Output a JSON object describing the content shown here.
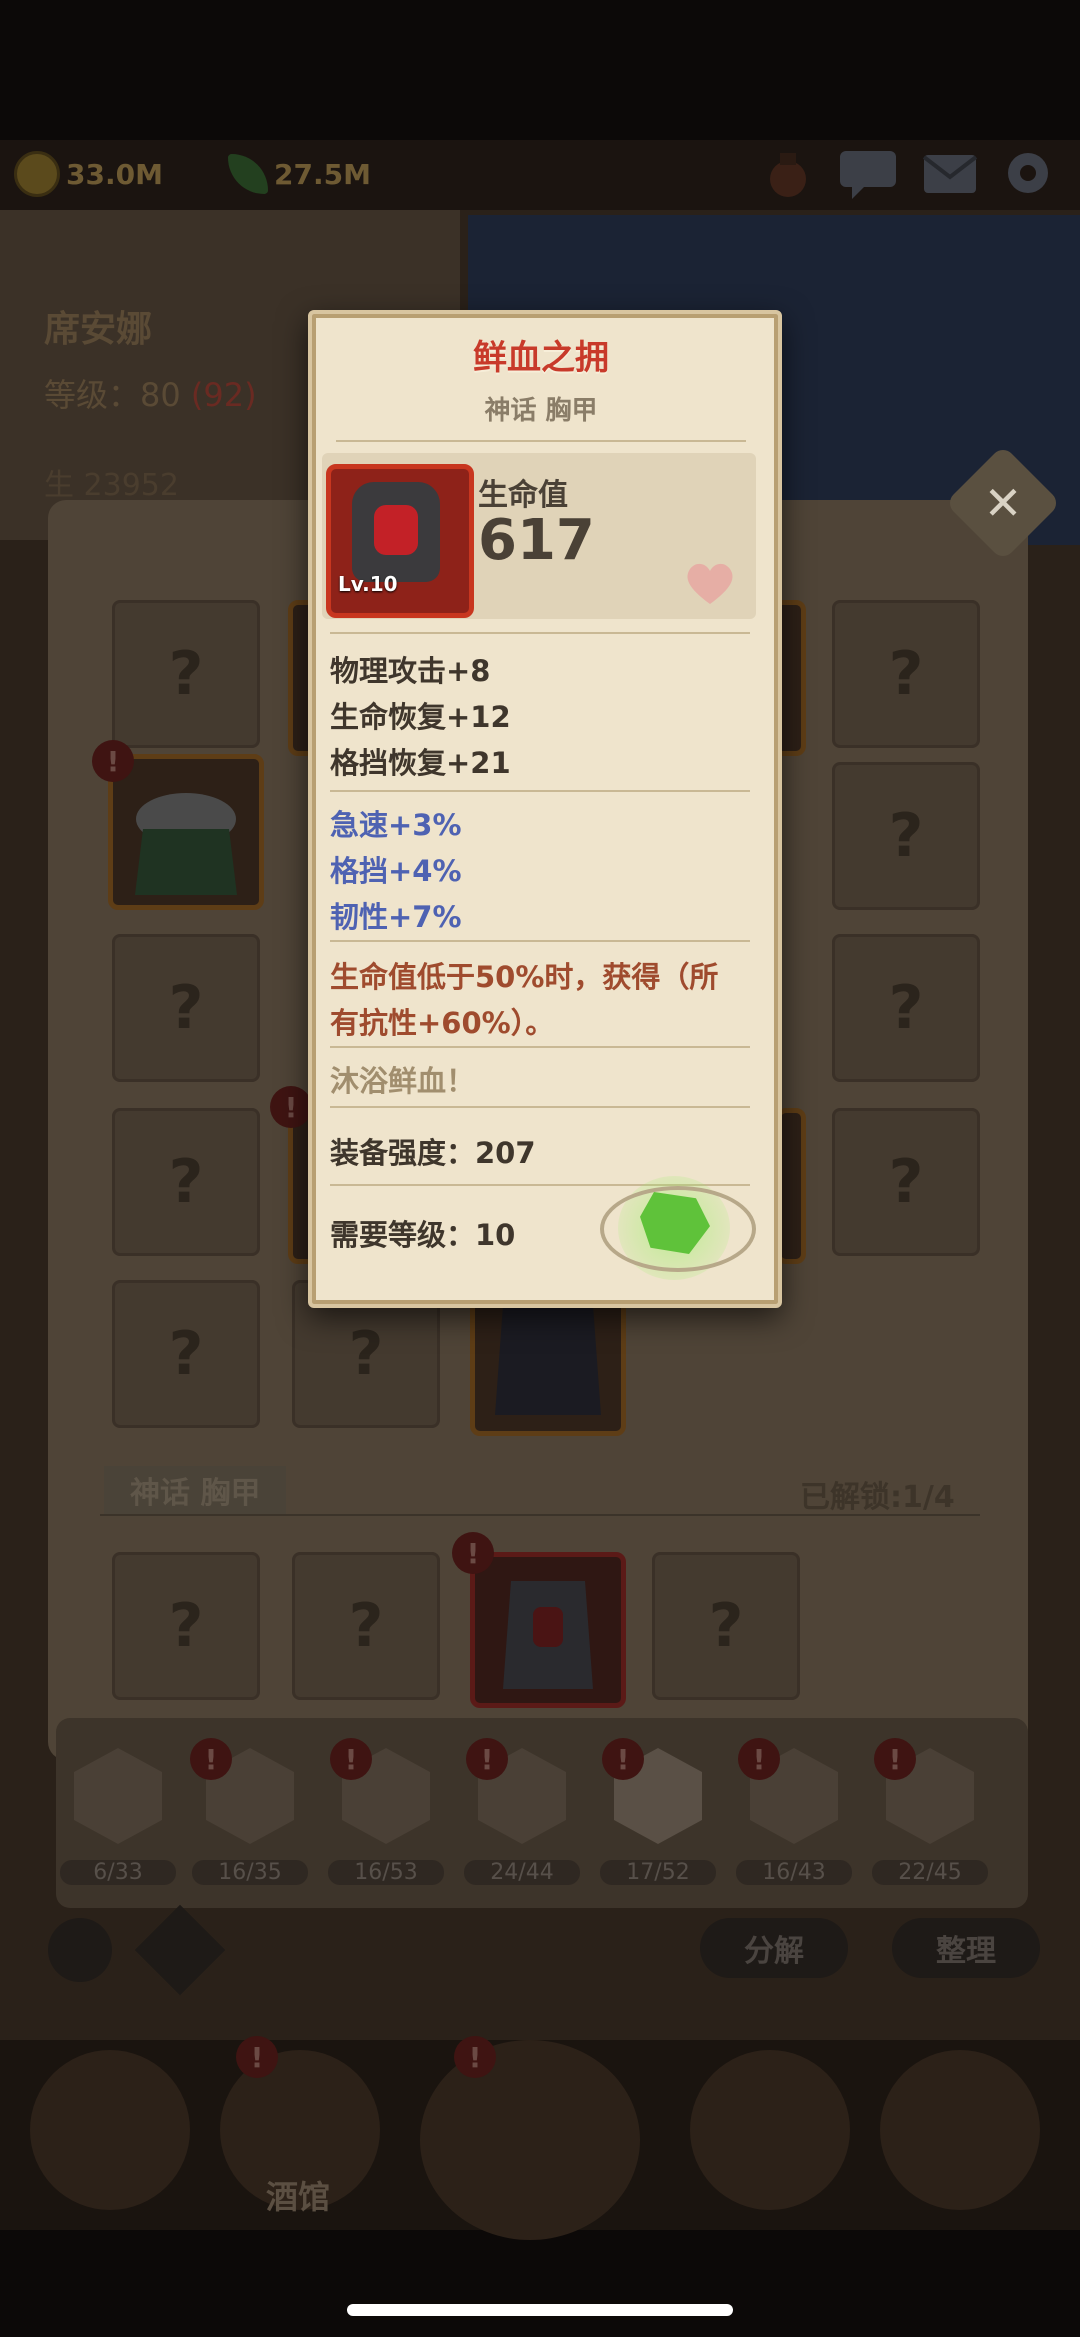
{
  "topbar": {
    "gold": "33.0M",
    "gems": "27.5M",
    "icons": [
      "potion-icon",
      "chat-icon",
      "mail-icon",
      "gear-icon"
    ]
  },
  "hero": {
    "name": "席安娜",
    "level_label": "等级：80",
    "level_max": "(92)",
    "hp_partial": "生    23952"
  },
  "grid": {
    "slot_mark": "?"
  },
  "section": {
    "title": "神话 胸甲",
    "unlocked": "已解锁:1/4"
  },
  "tabs": [
    {
      "icon": "sword-icon",
      "count": "6/33"
    },
    {
      "icon": "book-icon",
      "count": "16/35"
    },
    {
      "icon": "helmet-icon",
      "count": "16/53"
    },
    {
      "icon": "necklace-icon",
      "count": "24/44"
    },
    {
      "icon": "chest-armor-icon",
      "count": "17/52"
    },
    {
      "icon": "glove-icon",
      "count": "16/43"
    },
    {
      "icon": "ring-icon",
      "count": "22/45"
    }
  ],
  "buttons": {
    "decompose": "分解",
    "organize": "整理"
  },
  "nav": {
    "tavern": "酒馆"
  },
  "tooltip": {
    "name": "鲜血之拥",
    "subtitle": "神话 胸甲",
    "item_level": "Lv.10",
    "main_stat_label": "生命值",
    "main_stat_value": "617",
    "base_stats": [
      "物理攻击+8",
      "生命恢复+12",
      "格挡恢复+21"
    ],
    "bonus_stats": [
      "急速+3%",
      "格挡+4%",
      "韧性+7%"
    ],
    "effect_line1": "生命值低于50%时，获得（所",
    "effect_line2": "有抗性+60%）。",
    "flavor": "沐浴鲜血！",
    "power_label": "装备强度：207",
    "required_level_label": "需要等级：10"
  },
  "colors": {
    "title_red": "#c83a2a",
    "bonus_blue": "#4e62b2",
    "effect_brown": "#9f4b2e",
    "parchment": "#efe4cc"
  }
}
